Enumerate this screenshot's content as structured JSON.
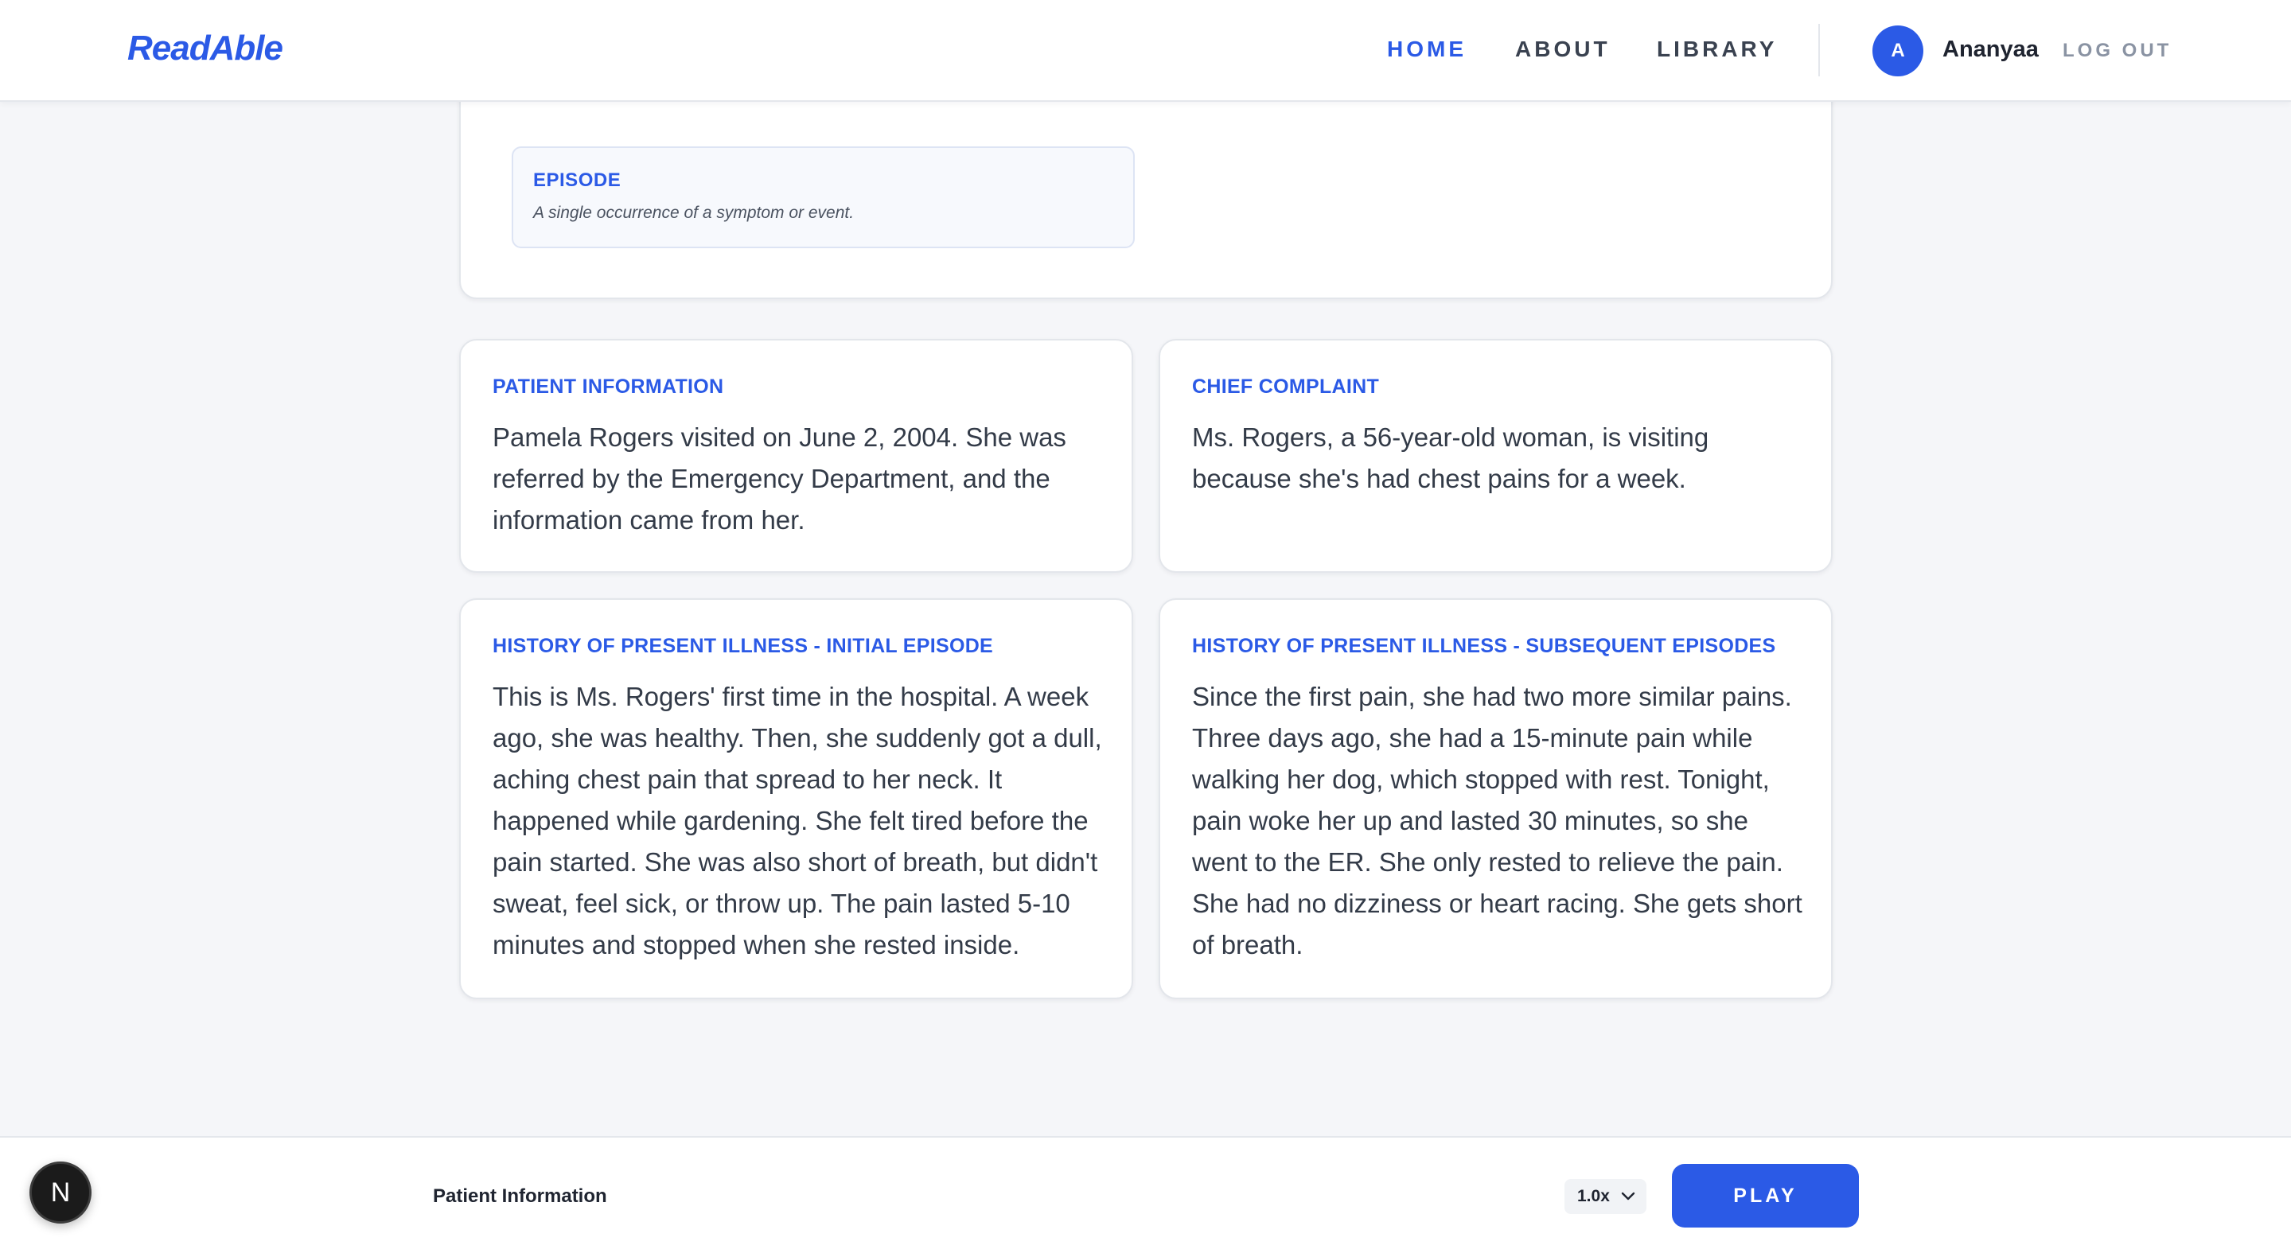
{
  "header": {
    "logo": "ReadAble",
    "nav": [
      {
        "label": "HOME",
        "active": true
      },
      {
        "label": "ABOUT",
        "active": false
      },
      {
        "label": "LIBRARY",
        "active": false
      }
    ],
    "user": {
      "initial": "A",
      "name": "Ananyaa",
      "logout_label": "LOG OUT"
    }
  },
  "glossary": {
    "terms": [
      {
        "term": "EPISODE",
        "definition": "A single occurrence of a symptom or event."
      }
    ]
  },
  "sections": [
    {
      "title": "PATIENT INFORMATION",
      "body": "Pamela Rogers visited on June 2, 2004. She was referred by the Emergency Department, and the information came from her."
    },
    {
      "title": "CHIEF COMPLAINT",
      "body": "Ms. Rogers, a 56-year-old woman, is visiting because she's had chest pains for a week."
    },
    {
      "title": "HISTORY OF PRESENT ILLNESS - INITIAL EPISODE",
      "body": "This is Ms. Rogers' first time in the hospital. A week ago, she was healthy. Then, she suddenly got a dull, aching chest pain that spread to her neck. It happened while gardening. She felt tired before the pain started. She was also short of breath, but didn't sweat, feel sick, or throw up. The pain lasted 5-10 minutes and stopped when she rested inside."
    },
    {
      "title": "HISTORY OF PRESENT ILLNESS - SUBSEQUENT EPISODES",
      "body": "Since the first pain, she had two more similar pains. Three days ago, she had a 15-minute pain while walking her dog, which stopped with rest. Tonight, pain woke her up and lasted 30 minutes, so she went to the ER. She only rested to relieve the pain. She had no dizziness or heart racing. She gets short of breath."
    }
  ],
  "player": {
    "badge": "N",
    "current_section": "Patient Information",
    "speed": "1.0x",
    "play_label": "PLAY"
  },
  "colors": {
    "accent": "#2b5ae6",
    "background": "#f5f6f9",
    "text": "#333b48"
  }
}
